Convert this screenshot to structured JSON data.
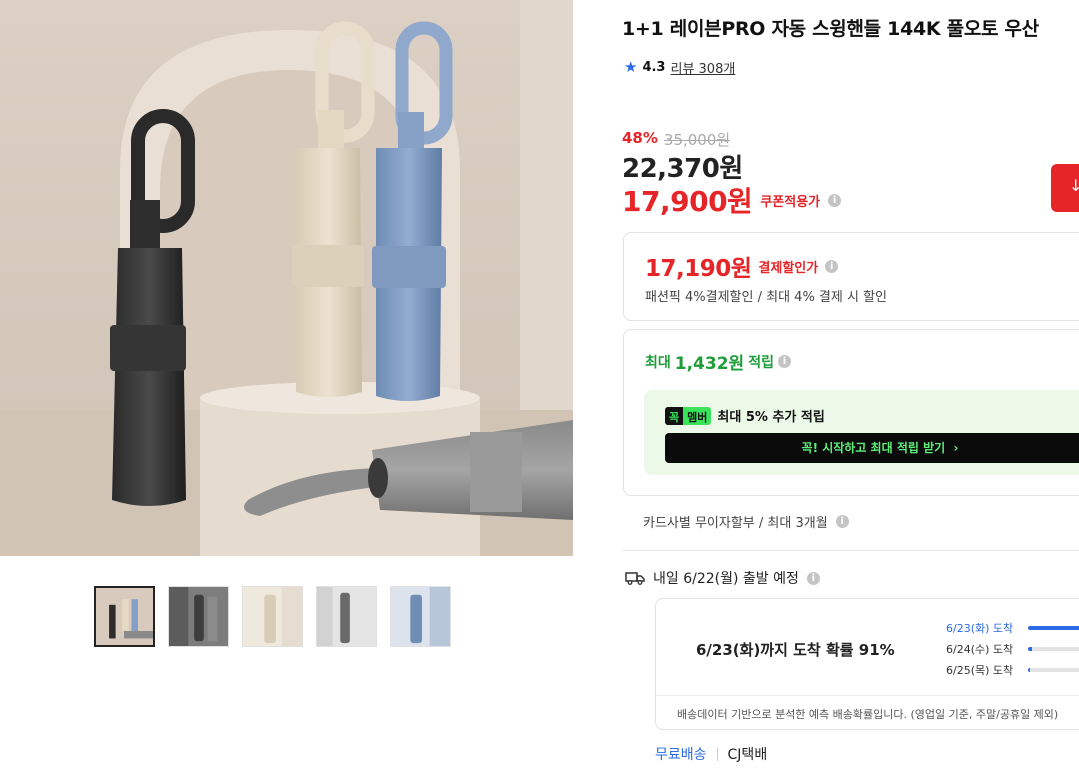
{
  "product": {
    "title": "1+1 레이븐PRO 자동 스윙핸들 144K 풀오토 우산",
    "rating": "4.3",
    "review_label": "리뷰 308개"
  },
  "price": {
    "discount_rate": "48%",
    "original": "35,000원",
    "sale": "22,370원",
    "coupon_price": "17,900원",
    "coupon_label": "쿠폰적용가"
  },
  "payment": {
    "price": "17,190원",
    "label": "결제할인가",
    "desc": "패션픽 4%결제할인 / 최대 4% 결제 시 할인"
  },
  "point": {
    "prefix": "최대",
    "amount": "1,432원",
    "suffix": "적립",
    "member_badge_1": "꼭",
    "member_badge_2": "멤버",
    "member_text": "최대 5% 추가 적립",
    "member_cta": "꼭! 시작하고 최대 적립 받기",
    "member_cta_icon": "chevron-right-icon"
  },
  "card": {
    "text": "카드사별 무이자할부 / 최대 3개월"
  },
  "shipping": {
    "depart": "내일 6/22(월) 출발 예정",
    "probability": "6/23(화)까지 도착 확률 91%",
    "days": [
      {
        "label": "6/23(화) 도착",
        "ratio": 0.91
      },
      {
        "label": "6/24(수) 도착",
        "ratio": 0.06
      },
      {
        "label": "6/25(목) 도착",
        "ratio": 0.03
      }
    ],
    "footer": "배송데이터 기반으로 분석한 예측 배송확률입니다. (영업일 기준, 주말/공휴일 제외)",
    "free_label": "무료배송",
    "carrier": "CJ택배"
  },
  "colors": {
    "accent_red": "#e52528",
    "accent_blue": "#2b6be3",
    "accent_green": "#1f9d3a"
  },
  "icons": {
    "rating": "star-icon",
    "info": "info-icon",
    "truck": "truck-icon"
  }
}
